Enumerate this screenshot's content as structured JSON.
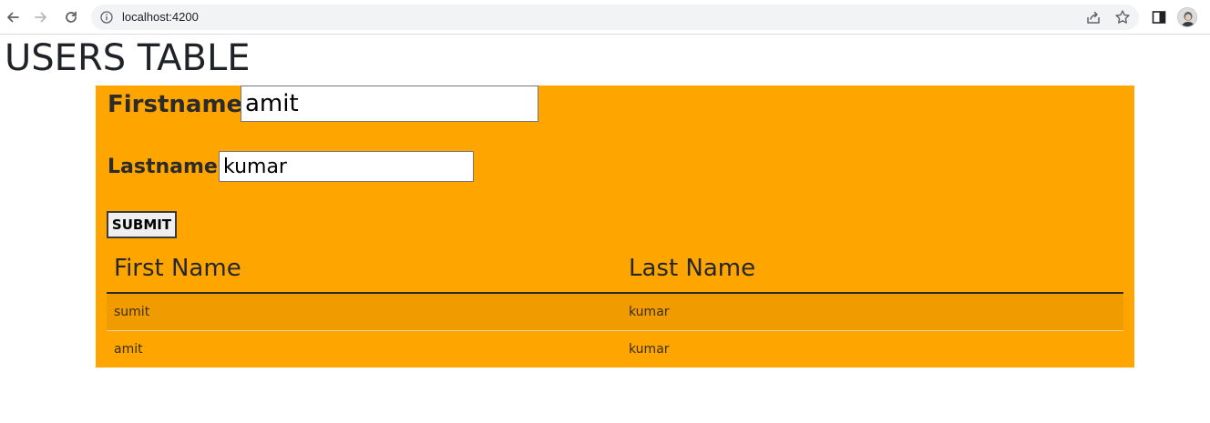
{
  "browser": {
    "url": "localhost:4200"
  },
  "page": {
    "title": "USERS TABLE"
  },
  "form": {
    "firstname_label": "Firstname :",
    "firstname_value": "amit",
    "lastname_label": "Lastname :",
    "lastname_value": "kumar",
    "submit_label": "SUBMIT"
  },
  "table": {
    "headers": [
      "First Name",
      "Last Name"
    ],
    "rows": [
      [
        "sumit",
        "kumar"
      ],
      [
        "amit",
        "kumar"
      ]
    ]
  },
  "colors": {
    "panel": "#ffa500",
    "striped_row": "#f09b00"
  },
  "icons": [
    "back-arrow-icon",
    "forward-arrow-icon",
    "reload-icon",
    "info-icon",
    "share-icon",
    "bookmark-star-icon",
    "side-panel-icon",
    "profile-avatar"
  ]
}
